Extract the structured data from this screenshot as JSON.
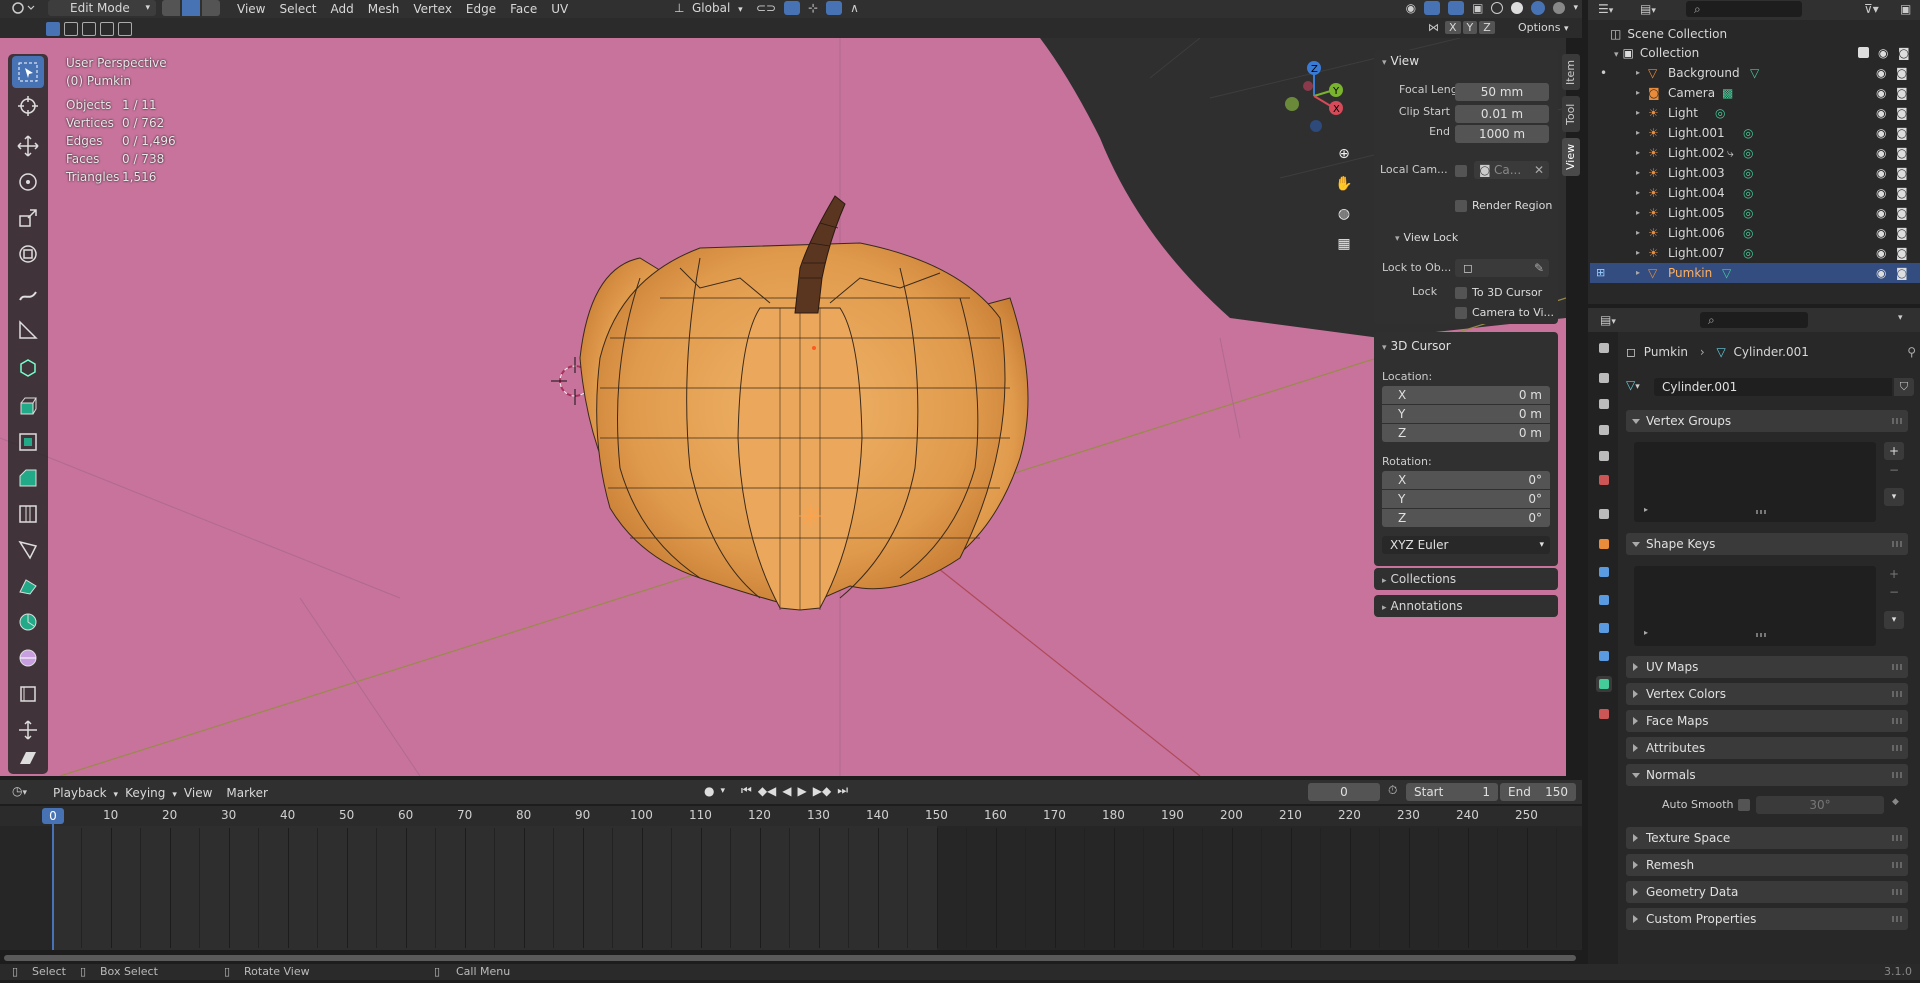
{
  "header": {
    "mode": "Edit Mode",
    "menus": [
      "View",
      "Select",
      "Add",
      "Mesh",
      "Vertex",
      "Edge",
      "Face",
      "UV"
    ],
    "orientation": "Global",
    "options": "Options",
    "xyz": [
      "X",
      "Y",
      "Z"
    ]
  },
  "overlay": {
    "perspective": "User Perspective",
    "object": "(0) Pumkin",
    "stats": [
      {
        "label": "Objects",
        "value": "1 / 11"
      },
      {
        "label": "Vertices",
        "value": "0 / 762"
      },
      {
        "label": "Edges",
        "value": "0 / 1,496"
      },
      {
        "label": "Faces",
        "value": "0 / 738"
      },
      {
        "label": "Triangles",
        "value": "1,516"
      }
    ]
  },
  "npanel": {
    "tabs": [
      "Item",
      "Tool",
      "View"
    ],
    "view_title": "View",
    "focal_label": "Focal Lengt",
    "focal_value": "50 mm",
    "clip_start_label": "Clip Start",
    "clip_start_value": "0.01 m",
    "end_label": "End",
    "end_value": "1000 m",
    "local_cam_label": "Local Cam...",
    "local_cam_value": "Ca...",
    "render_region": "Render Region",
    "view_lock": "View Lock",
    "lock_to_obj": "Lock to Ob...",
    "lock_label": "Lock",
    "to_3d_cursor": "To 3D Cursor",
    "camera_to_view": "Camera to Vi...",
    "cursor_title": "3D Cursor",
    "location_label": "Location:",
    "loc": [
      {
        "axis": "X",
        "value": "0 m"
      },
      {
        "axis": "Y",
        "value": "0 m"
      },
      {
        "axis": "Z",
        "value": "0 m"
      }
    ],
    "rotation_label": "Rotation:",
    "rot": [
      {
        "axis": "X",
        "value": "0°"
      },
      {
        "axis": "Y",
        "value": "0°"
      },
      {
        "axis": "Z",
        "value": "0°"
      }
    ],
    "euler": "XYZ Euler",
    "collections": "Collections",
    "annotations": "Annotations"
  },
  "timeline": {
    "menus": [
      "Playback",
      "Keying",
      "View",
      "Marker"
    ],
    "current_frame": "0",
    "start_label": "Start",
    "start_value": "1",
    "end_label": "End",
    "end_value": "150",
    "ticks": [
      "0",
      "10",
      "20",
      "30",
      "40",
      "50",
      "60",
      "70",
      "80",
      "90",
      "100",
      "110",
      "120",
      "130",
      "140",
      "150",
      "160",
      "170",
      "180",
      "190",
      "200",
      "210",
      "220",
      "230",
      "240",
      "250"
    ]
  },
  "status": {
    "items": [
      "Select",
      "Box Select",
      "Rotate View",
      "Call Menu"
    ],
    "version": "3.1.0"
  },
  "outliner": {
    "scene_collection": "Scene Collection",
    "collection": "Collection",
    "items": [
      "Background",
      "Camera",
      "Light",
      "Light.001",
      "Light.002",
      "Light.003",
      "Light.004",
      "Light.005",
      "Light.006",
      "Light.007",
      "Pumkin"
    ]
  },
  "properties": {
    "object": "Pumkin",
    "mesh": "Cylinder.001",
    "datablock": "Cylinder.001",
    "vertex_groups": "Vertex Groups",
    "shape_keys": "Shape Keys",
    "uv_maps": "UV Maps",
    "vertex_colors": "Vertex Colors",
    "face_maps": "Face Maps",
    "attributes": "Attributes",
    "normals": "Normals",
    "auto_smooth": "Auto Smooth",
    "angle": "30°",
    "texture_space": "Texture Space",
    "remesh": "Remesh",
    "geometry_data": "Geometry Data",
    "custom_properties": "Custom Properties"
  },
  "colors": {
    "viewport_bg": "#c7739c",
    "pumpkin": "#e29e50",
    "selected_row": "#334d80",
    "header": "#303030"
  }
}
